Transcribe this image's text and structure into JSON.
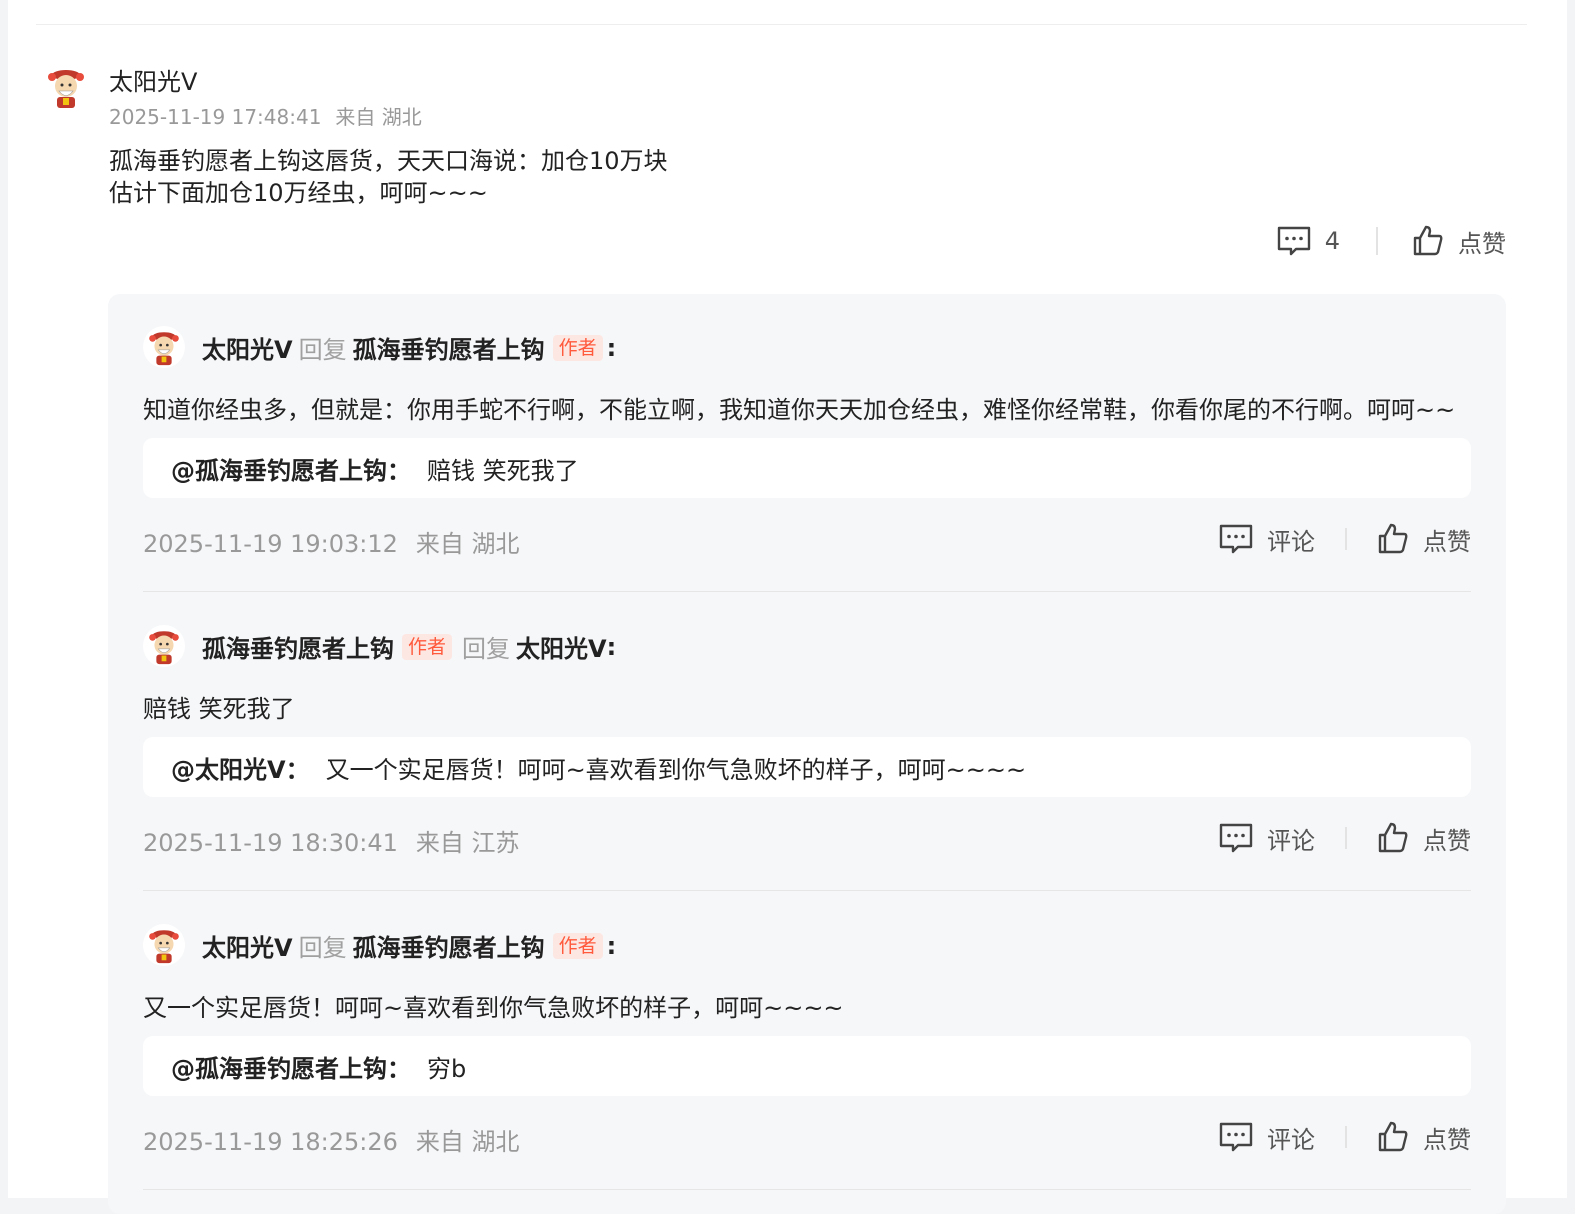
{
  "main_comment": {
    "username": "太阳光V",
    "timestamp": "2025-11-19 17:48:41",
    "location": "来自 湖北",
    "text_line1": "孤海垂钓愿者上钩这唇货，天天口海说：加仓10万块",
    "text_line2": "估计下面加仓10万经虫，呵呵~~~",
    "comment_count": "4",
    "like_label": "点赞",
    "icons": [
      "comment-icon",
      "thumb-up-icon",
      "avatar-icon"
    ]
  },
  "replies": [
    {
      "from": "太阳光V",
      "from_is_author": false,
      "reply_word": "回复",
      "to": "孤海垂钓愿者上钩",
      "to_is_author": true,
      "author_badge": "作者",
      "colon": ":",
      "text": "知道你经虫多，但就是：你用手蛇不行啊，不能立啊，我知道你天天加仓经虫，难怪你经常鞋，你看你尾的不行啊。呵呵~~",
      "quote_user": "@孤海垂钓愿者上钩",
      "quote_colon": "：",
      "quote_text": "赔钱 笑死我了",
      "timestamp": "2025-11-19 19:03:12",
      "location": "来自 湖北",
      "comment_label": "评论",
      "like_label": "点赞"
    },
    {
      "from": "孤海垂钓愿者上钩",
      "from_is_author": true,
      "reply_word": "回复",
      "to": "太阳光V",
      "to_is_author": false,
      "author_badge": "作者",
      "colon": ":",
      "text": "赔钱 笑死我了",
      "quote_user": "@太阳光V",
      "quote_colon": "：",
      "quote_text": "又一个实足唇货！呵呵~喜欢看到你气急败坏的样子，呵呵~~~~",
      "timestamp": "2025-11-19 18:30:41",
      "location": "来自 江苏",
      "comment_label": "评论",
      "like_label": "点赞"
    },
    {
      "from": "太阳光V",
      "from_is_author": false,
      "reply_word": "回复",
      "to": "孤海垂钓愿者上钩",
      "to_is_author": true,
      "author_badge": "作者",
      "colon": ":",
      "text": "又一个实足唇货！呵呵~喜欢看到你气急败坏的样子，呵呵~~~~",
      "quote_user": "@孤海垂钓愿者上钩",
      "quote_colon": "：",
      "quote_text": "穷b",
      "timestamp": "2025-11-19 18:25:26",
      "location": "来自 湖北",
      "comment_label": "评论",
      "like_label": "点赞"
    }
  ],
  "colors": {
    "author_badge_text": "#ff5a3c",
    "author_badge_bg": "#fde7e3",
    "muted_text": "#999999",
    "panel_bg": "#f6f7f9"
  }
}
